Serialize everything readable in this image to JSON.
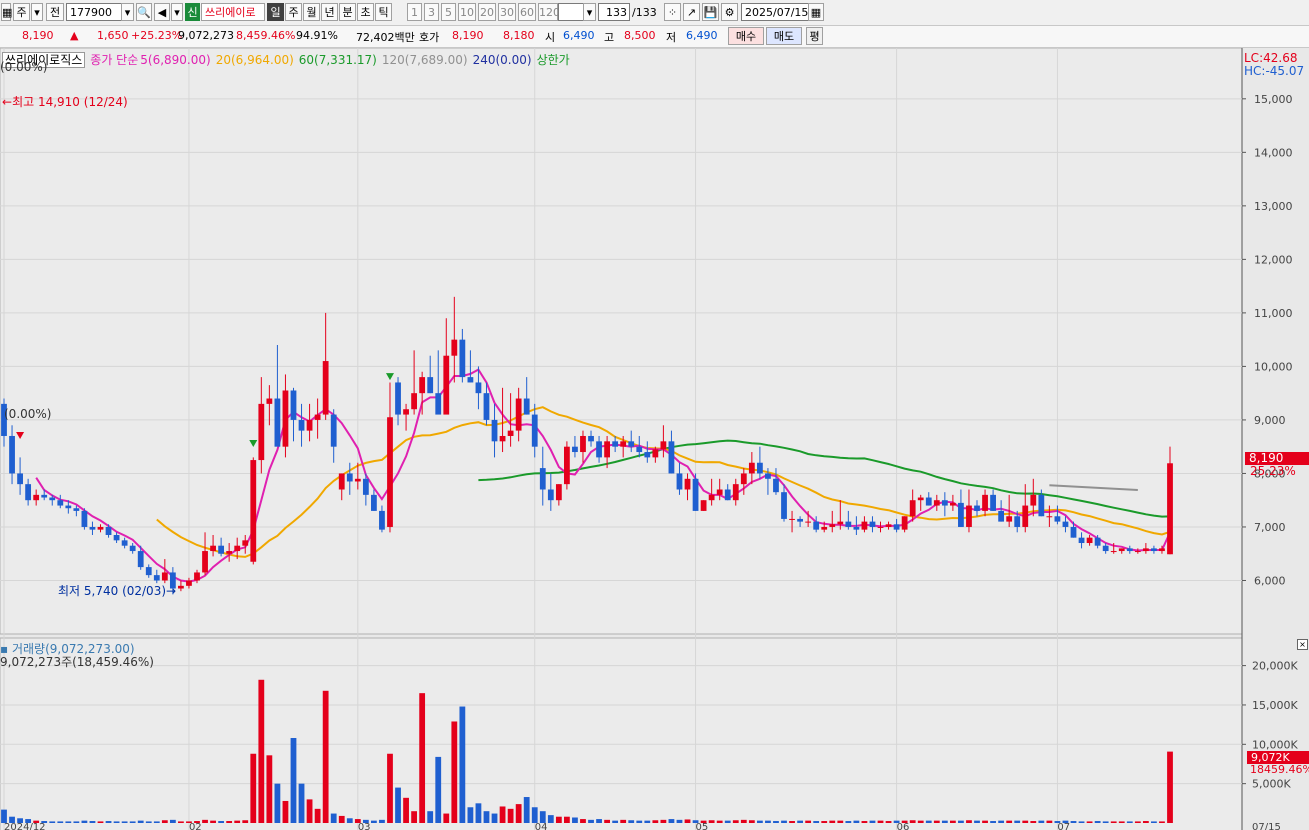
{
  "toolbar": {
    "mode_label": "주",
    "period_label": "전",
    "code": "177900",
    "credit_badge": "신",
    "stock_name": "쓰리에이로",
    "period_tabs": [
      "일",
      "주",
      "월",
      "년",
      "분",
      "초",
      "틱"
    ],
    "interval_tabs": [
      "1",
      "3",
      "5",
      "10",
      "20",
      "30",
      "60",
      "120"
    ],
    "count_value": "133",
    "count_total": "/133",
    "date_value": "2025/07/15"
  },
  "quote": {
    "price": "8,190",
    "change_arrow": "▲",
    "change": "1,650",
    "change_rate": "+25.23%",
    "volume": "9,072,273",
    "volume_rate": "8,459.46%",
    "turnover": "94.91%",
    "amount": "72,402백만",
    "hoga_label": "호가",
    "ask": "8,190",
    "bid": "8,180",
    "open_label": "시",
    "open": "6,490",
    "high_label": "고",
    "high": "8,500",
    "low_label": "저",
    "low": "6,490",
    "buy_button": "매수",
    "sell_button": "매도",
    "eval_button": "평"
  },
  "legend": {
    "stock_name": "쓰리에이로직스",
    "close_label": "종가 단순",
    "ma5": "5(6,890.00)",
    "ma20": "20(6,964.00)",
    "ma60": "60(7,331.17)",
    "ma120": "120(7,689.00)",
    "ma240": "240(0.00)",
    "upper_limit": "상한가",
    "pct_top": "(0.00%)",
    "pct_mid": "(0.00%)",
    "lc": "LC:42.68",
    "hc": "HC:-45.07",
    "max_label": "최고 14,910 (12/24)",
    "min_label": "최저 5,740 (02/03)",
    "price_tag": "8,190",
    "price_tag_pct": "25.23%"
  },
  "volume_panel": {
    "title": "거래량(9,072,273.00)",
    "subtitle": "9,072,273주(18,459.46%)",
    "tag_value": "9,072K",
    "tag_pct": "18459.46%"
  },
  "colors": {
    "up": "#e4001b",
    "down": "#1f5fd0",
    "ma5": "#e020b0",
    "ma20": "#f0a800",
    "ma60": "#1a9a2a",
    "ma120": "#909090"
  },
  "chart_data": {
    "type": "candlestick",
    "y_ticks": [
      "15,000",
      "14,000",
      "13,000",
      "12,000",
      "11,000",
      "10,000",
      "9,000",
      "8,000",
      "7,000",
      "6,000"
    ],
    "vol_ticks": [
      "20,000K",
      "15,000K",
      "10,000K",
      "5,000K"
    ],
    "x_ticks": [
      "2024/12",
      "02",
      "03",
      "04",
      "05",
      "06",
      "07",
      "07/15"
    ],
    "ylim": [
      5000,
      15800
    ],
    "vol_ylim": [
      0,
      23000
    ],
    "candles": [
      [
        9300,
        9400,
        8500,
        8700
      ],
      [
        8700,
        8900,
        7800,
        8000
      ],
      [
        8000,
        8300,
        7600,
        7800
      ],
      [
        7800,
        7900,
        7400,
        7500
      ],
      [
        7500,
        7700,
        7400,
        7600
      ],
      [
        7600,
        7700,
        7500,
        7550
      ],
      [
        7550,
        7600,
        7400,
        7500
      ],
      [
        7500,
        7600,
        7350,
        7400
      ],
      [
        7400,
        7500,
        7250,
        7350
      ],
      [
        7350,
        7400,
        7200,
        7300
      ],
      [
        7300,
        7350,
        6950,
        7000
      ],
      [
        7000,
        7100,
        6850,
        6950
      ],
      [
        6950,
        7050,
        6900,
        7000
      ],
      [
        7000,
        7050,
        6800,
        6850
      ],
      [
        6850,
        6900,
        6700,
        6750
      ],
      [
        6750,
        6800,
        6600,
        6650
      ],
      [
        6650,
        6700,
        6500,
        6550
      ],
      [
        6550,
        6650,
        6200,
        6250
      ],
      [
        6250,
        6300,
        6050,
        6100
      ],
      [
        6100,
        6200,
        5950,
        6000
      ],
      [
        6000,
        6400,
        5950,
        6150
      ],
      [
        6150,
        6250,
        5740,
        5850
      ],
      [
        5850,
        6000,
        5800,
        5900
      ],
      [
        5900,
        6050,
        5850,
        6000
      ],
      [
        6000,
        6200,
        5950,
        6150
      ],
      [
        6150,
        6900,
        6100,
        6550
      ],
      [
        6550,
        6850,
        6450,
        6650
      ],
      [
        6650,
        6800,
        6450,
        6500
      ],
      [
        6500,
        6700,
        6350,
        6550
      ],
      [
        6550,
        6800,
        6400,
        6650
      ],
      [
        6650,
        6850,
        6500,
        6750
      ],
      [
        6350,
        8300,
        6300,
        8250
      ],
      [
        8250,
        9800,
        8000,
        9300
      ],
      [
        9300,
        9650,
        8900,
        9400
      ],
      [
        9400,
        10400,
        9000,
        8500
      ],
      [
        8500,
        9850,
        8300,
        9550
      ],
      [
        9550,
        9600,
        8600,
        9000
      ],
      [
        9000,
        9300,
        8500,
        8800
      ],
      [
        8800,
        9300,
        8600,
        9000
      ],
      [
        9000,
        9400,
        8650,
        9100
      ],
      [
        9100,
        11000,
        9000,
        10100
      ],
      [
        9100,
        9200,
        8200,
        8500
      ],
      [
        7700,
        8000,
        7500,
        8000
      ],
      [
        8000,
        8200,
        7600,
        7850
      ],
      [
        7850,
        8200,
        7700,
        7900
      ],
      [
        7900,
        8000,
        7400,
        7600
      ],
      [
        7600,
        7700,
        7300,
        7300
      ],
      [
        7300,
        7400,
        6900,
        6950
      ],
      [
        7000,
        9700,
        6900,
        9050
      ],
      [
        9700,
        9800,
        8900,
        9100
      ],
      [
        9100,
        9300,
        8800,
        9200
      ],
      [
        9200,
        10300,
        9100,
        9500
      ],
      [
        9500,
        9900,
        9100,
        9800
      ],
      [
        9800,
        10200,
        9500,
        9500
      ],
      [
        9500,
        10300,
        9200,
        9100
      ],
      [
        9100,
        10900,
        9200,
        10200
      ],
      [
        10200,
        11300,
        9700,
        10500
      ],
      [
        10500,
        10700,
        9700,
        9800
      ],
      [
        9800,
        10300,
        9700,
        9700
      ],
      [
        9700,
        10000,
        9200,
        9500
      ],
      [
        9500,
        9700,
        8900,
        9000
      ],
      [
        9000,
        9300,
        8300,
        8600
      ],
      [
        8600,
        9600,
        8400,
        8700
      ],
      [
        8700,
        9500,
        8500,
        8800
      ],
      [
        8800,
        9600,
        8600,
        9400
      ],
      [
        9400,
        9800,
        9100,
        9100
      ],
      [
        9100,
        9300,
        8300,
        8500
      ],
      [
        8100,
        8500,
        7400,
        7700
      ],
      [
        7700,
        8000,
        7300,
        7500
      ],
      [
        7500,
        7800,
        7400,
        7800
      ],
      [
        7800,
        8600,
        7700,
        8500
      ],
      [
        8500,
        8700,
        8300,
        8400
      ],
      [
        8400,
        8800,
        8200,
        8700
      ],
      [
        8700,
        8800,
        8500,
        8600
      ],
      [
        8600,
        8700,
        8200,
        8300
      ],
      [
        8300,
        8700,
        8100,
        8600
      ],
      [
        8600,
        8700,
        8400,
        8500
      ],
      [
        8500,
        8700,
        8300,
        8600
      ],
      [
        8600,
        8800,
        8400,
        8500
      ],
      [
        8500,
        8700,
        8300,
        8400
      ],
      [
        8400,
        8600,
        8200,
        8300
      ],
      [
        8300,
        8500,
        8200,
        8450
      ],
      [
        8450,
        8900,
        8300,
        8600
      ],
      [
        8600,
        8800,
        8000,
        8000
      ],
      [
        8000,
        8200,
        7600,
        7700
      ],
      [
        7700,
        8000,
        7500,
        7900
      ],
      [
        7900,
        8000,
        7300,
        7300
      ],
      [
        7300,
        7500,
        7300,
        7500
      ],
      [
        7500,
        7900,
        7400,
        7600
      ],
      [
        7600,
        7900,
        7500,
        7700
      ],
      [
        7700,
        7800,
        7500,
        7500
      ],
      [
        7500,
        7900,
        7400,
        7800
      ],
      [
        7800,
        8100,
        7600,
        8000
      ],
      [
        8000,
        8400,
        7800,
        8200
      ],
      [
        8200,
        8500,
        7900,
        8000
      ],
      [
        8000,
        8100,
        7600,
        7900
      ],
      [
        7900,
        8100,
        7600,
        7650
      ],
      [
        7650,
        7800,
        7100,
        7150
      ],
      [
        7150,
        7300,
        6900,
        7150
      ],
      [
        7150,
        7200,
        7000,
        7100
      ],
      [
        7100,
        7300,
        7000,
        7100
      ],
      [
        7100,
        7200,
        6900,
        6950
      ],
      [
        6950,
        7100,
        6900,
        7000
      ],
      [
        7000,
        7300,
        6900,
        7050
      ],
      [
        7050,
        7500,
        6950,
        7100
      ],
      [
        7100,
        7300,
        6950,
        7000
      ],
      [
        7000,
        7200,
        6850,
        6950
      ],
      [
        6950,
        7200,
        6900,
        7100
      ],
      [
        7100,
        7200,
        6900,
        7000
      ],
      [
        7000,
        7100,
        6900,
        7000
      ],
      [
        7000,
        7100,
        6950,
        7050
      ],
      [
        7050,
        7150,
        6900,
        6950
      ],
      [
        6950,
        7200,
        6900,
        7200
      ],
      [
        7200,
        7700,
        7100,
        7500
      ],
      [
        7500,
        7600,
        7300,
        7550
      ],
      [
        7550,
        7650,
        7400,
        7400
      ],
      [
        7400,
        7600,
        7300,
        7500
      ],
      [
        7500,
        7650,
        7200,
        7400
      ],
      [
        7400,
        7600,
        7300,
        7450
      ],
      [
        7450,
        7700,
        7000,
        7000
      ],
      [
        7000,
        7700,
        6900,
        7400
      ],
      [
        7400,
        7500,
        7200,
        7300
      ],
      [
        7300,
        7700,
        7200,
        7600
      ],
      [
        7600,
        7700,
        7300,
        7300
      ],
      [
        7300,
        7500,
        7100,
        7100
      ],
      [
        7100,
        7600,
        7000,
        7200
      ],
      [
        7200,
        7300,
        6900,
        7000
      ],
      [
        7000,
        7800,
        6900,
        7400
      ],
      [
        7400,
        7900,
        7200,
        7600
      ],
      [
        7600,
        7700,
        7200,
        7200
      ],
      [
        7200,
        7400,
        7000,
        7200
      ],
      [
        7200,
        7400,
        7050,
        7100
      ],
      [
        7100,
        7200,
        6900,
        7000
      ],
      [
        7000,
        7100,
        6800,
        6800
      ],
      [
        6800,
        6900,
        6600,
        6700
      ],
      [
        6700,
        6850,
        6650,
        6800
      ],
      [
        6800,
        6850,
        6600,
        6650
      ],
      [
        6650,
        6700,
        6500,
        6550
      ],
      [
        6550,
        6700,
        6500,
        6550
      ],
      [
        6550,
        6600,
        6500,
        6600
      ],
      [
        6600,
        6650,
        6500,
        6550
      ],
      [
        6550,
        6600,
        6500,
        6550
      ],
      [
        6550,
        6700,
        6500,
        6600
      ],
      [
        6600,
        6650,
        6500,
        6550
      ],
      [
        6550,
        6650,
        6500,
        6600
      ],
      [
        6490,
        8500,
        6490,
        8190
      ]
    ],
    "volumes": [
      1700,
      800,
      600,
      500,
      300,
      250,
      200,
      200,
      200,
      200,
      300,
      250,
      200,
      250,
      200,
      200,
      200,
      300,
      200,
      200,
      350,
      400,
      200,
      200,
      250,
      400,
      300,
      250,
      250,
      300,
      350,
      8800,
      18200,
      8600,
      5000,
      2800,
      10800,
      5000,
      3000,
      1800,
      16800,
      1200,
      900,
      600,
      500,
      400,
      300,
      400,
      8800,
      4500,
      3200,
      1500,
      16500,
      1500,
      8400,
      1200,
      12900,
      14800,
      2000,
      2500,
      1500,
      1200,
      2100,
      1800,
      2400,
      3300,
      2000,
      1500,
      1000,
      800,
      800,
      700,
      500,
      400,
      500,
      400,
      300,
      400,
      350,
      300,
      300,
      350,
      400,
      500,
      400,
      450,
      350,
      300,
      350,
      300,
      300,
      350,
      400,
      350,
      300,
      300,
      250,
      300,
      250,
      300,
      300,
      250,
      250,
      300,
      300,
      250,
      300,
      250,
      300,
      300,
      250,
      300,
      300,
      350,
      300,
      300,
      300,
      300,
      300,
      300,
      350,
      300,
      300,
      250,
      300,
      300,
      300,
      300,
      250,
      300,
      300,
      250,
      300,
      250,
      200,
      200,
      250,
      200,
      200,
      200,
      200,
      200,
      250,
      200,
      200,
      9072
    ]
  }
}
